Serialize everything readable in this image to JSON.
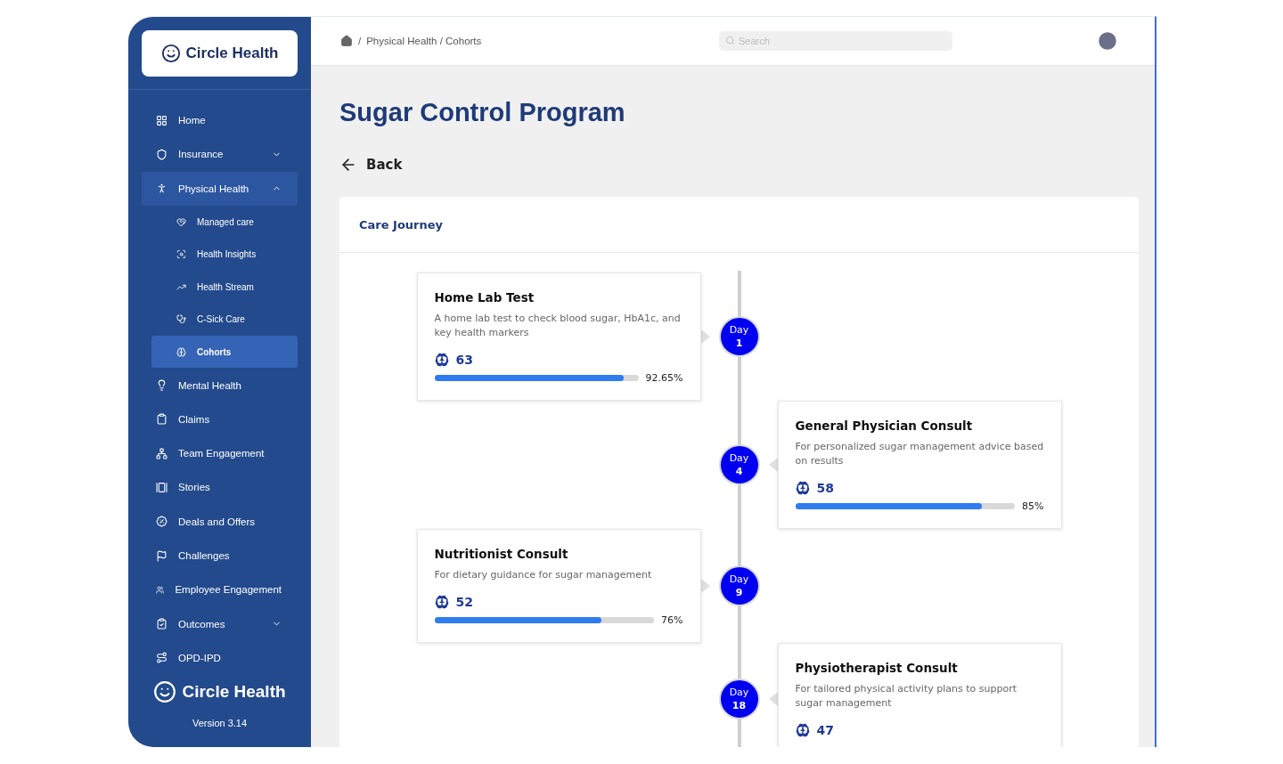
{
  "brand": {
    "name": "Circle Health"
  },
  "sidebar": {
    "items": [
      {
        "label": "Home",
        "selected": false
      },
      {
        "label": "Insurance",
        "selected": false,
        "expanded": false
      },
      {
        "label": "Physical Health",
        "selected": false,
        "expanded": true,
        "children": [
          {
            "label": "Managed care",
            "selected": false
          },
          {
            "label": "Health Insights",
            "selected": false
          },
          {
            "label": "Health Stream",
            "selected": false
          },
          {
            "label": "C-Sick Care",
            "selected": false
          },
          {
            "label": "Cohorts",
            "selected": true
          }
        ]
      },
      {
        "label": "Mental Health",
        "selected": false
      },
      {
        "label": "Claims",
        "selected": false
      },
      {
        "label": "Team Engagement",
        "selected": false
      },
      {
        "label": "Stories",
        "selected": false
      },
      {
        "label": "Deals and Offers",
        "selected": false
      },
      {
        "label": "Challenges",
        "selected": false
      },
      {
        "label": "Employee Engagement",
        "selected": false
      },
      {
        "label": "Outcomes",
        "selected": false,
        "expanded": false
      },
      {
        "label": "OPD-IPD",
        "selected": false
      }
    ],
    "footer_brand": "Circle Health",
    "version": "Version 3.14"
  },
  "header": {
    "breadcrumb": [
      "/",
      "Physical Health / Cohorts"
    ],
    "search": {
      "placeholder": "Search"
    }
  },
  "page": {
    "title": "Sugar Control Program",
    "back": "Back"
  },
  "journey": {
    "title": "Care Journey",
    "steps": [
      {
        "title": "Home Lab Test",
        "description": "A home lab test to check blood sugar, HbA1c, and key health markers",
        "count": "63",
        "level": 0.9265,
        "percent": "92.65%",
        "day_label": "Day",
        "day": "1"
      },
      {
        "title": "General Physician Consult",
        "description": "For personalized sugar management advice based on results",
        "count": "58",
        "level": 0.85,
        "percent": "85%",
        "day_label": "Day",
        "day": "4"
      },
      {
        "title": "Nutritionist Consult",
        "description": "For dietary guidance for sugar management",
        "count": "52",
        "level": 0.76,
        "percent": "76%",
        "day_label": "Day",
        "day": "9"
      },
      {
        "title": "Physiotherapist Consult",
        "description": "For tailored physical activity plans to support sugar management",
        "count": "47",
        "day_label": "Day",
        "day": "18"
      }
    ]
  }
}
